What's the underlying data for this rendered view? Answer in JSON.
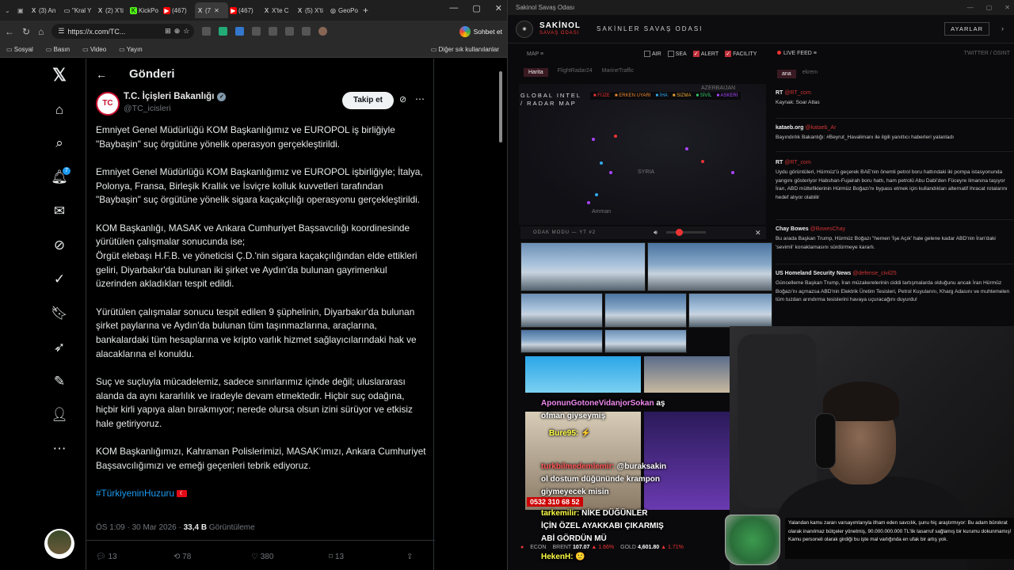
{
  "browser": {
    "tabs": [
      {
        "label": "(3) An",
        "icon": "X"
      },
      {
        "label": "\"Kral Y",
        "icon": "▭"
      },
      {
        "label": "(2) X'ti",
        "icon": "X"
      },
      {
        "label": "KickPo",
        "icon": "K"
      },
      {
        "label": "(467)",
        "icon": "▶"
      },
      {
        "label": "(7",
        "icon": "X"
      },
      {
        "label": "(467)",
        "icon": "▶"
      },
      {
        "label": "X'te C",
        "icon": "X"
      },
      {
        "label": "(5) X'ti",
        "icon": "X"
      },
      {
        "label": "GeoPo",
        "icon": "◎"
      }
    ],
    "url": "https://x.com/TC...",
    "chat_label": "Sohbet et",
    "bookmarks": [
      "Sosyal",
      "Basın",
      "Video",
      "Yayın"
    ],
    "bookmarks_right": "Diğer sık kullanılanlar"
  },
  "x": {
    "page_title": "Gönderi",
    "notifications_badge": "7",
    "account_name": "T.C. İçişleri Bakanlığı",
    "account_handle": "@TC_icisleri",
    "follow_label": "Takip et",
    "tweet_paragraphs": [
      "Emniyet Genel Müdürlüğü KOM Başkanlığımız ve EUROPOL iş birliğiyle \"Baybaşin\" suç örgütüne yönelik operasyon gerçekleştirildi.",
      "Emniyet Genel Müdürlüğü KOM Başkanlığımız ve EUROPOL işbirliğiyle; İtalya, Polonya, Fransa, Birleşik Krallık ve İsviçre kolluk kuvvetleri tarafından \"Baybaşin\" suç örgütüne yönelik sigara kaçakçılığı operasyonu gerçekleştirildi.",
      "KOM Başkanlığı, MASAK ve Ankara Cumhuriyet Başsavcılığı koordinesinde yürütülen çalışmalar sonucunda ise;\nÖrgüt elebaşı H.F.B. ve yöneticisi Ç.D.'nin sigara kaçakçılığından elde ettikleri geliri, Diyarbakır'da bulunan iki şirket ve Aydın'da bulunan gayrimenkul üzerinden akladıkları tespit edildi.",
      "Yürütülen çalışmalar sonucu tespit edilen 9 şüphelinin, Diyarbakır'da bulunan şirket paylarına ve Aydın'da bulunan tüm taşınmazlarına, araçlarına, bankalardaki tüm hesaplarına ve kripto varlık hizmet sağlayıcılarındaki hak ve alacaklarına el konuldu.",
      "Suç ve suçluyla mücadelemiz, sadece sınırlarımız içinde değil; uluslararası alanda da aynı kararlılık ve iradeyle devam etmektedir. Hiçbir suç odağına, hiçbir kirli yapıya alan bırakmıyor; nerede olursa olsun izini sürüyor ve etkisiz hale getiriyoruz.",
      "KOM Başkanlığımızı, Kahraman Polislerimizi, MASAK'ımızı, Ankara Cumhuriyet Başsavcılığımızı ve emeği geçenleri tebrik ediyoruz."
    ],
    "hashtag": "#TürkiyeninHuzuru",
    "time": "ÖS 1:09 · 30 Mar 2026 · ",
    "views": "33,4 B",
    "views_label": " Görüntüleme",
    "replies": "13",
    "reposts": "78",
    "likes": "380",
    "bookmarks": "13"
  },
  "stream": {
    "window_title": "Sakinol Savaş Odası",
    "app_name": "SAKİNOL",
    "app_sub": "SAVAŞ ODASI",
    "room_title": "SAKİNLER SAVAŞ ODASI",
    "settings_label": "AYARLAR",
    "map_label": "MAP ≡",
    "filters": [
      {
        "label": "AIR",
        "on": false
      },
      {
        "label": "SEA",
        "on": false
      },
      {
        "label": "ALERT",
        "on": true
      },
      {
        "label": "FACILITY",
        "on": true
      }
    ],
    "live_feed_label": "LIVE FEED ≡",
    "source_label": "TWITTER / OSINT",
    "map_tabs": [
      "Harita",
      "FlightRadar24",
      "MarineTraffic"
    ],
    "feed_tabs": [
      "ana",
      "ekrem"
    ],
    "map_title_1": "GLOBAL INTEL",
    "map_title_2": "/ RADAR MAP",
    "legend": [
      "FÜZE",
      "ERKEN UYARI",
      "İHA",
      "SIZMA",
      "SİVİL",
      "ASKERİ"
    ],
    "map_places": [
      "AZERBAIJAN",
      "SYRIA",
      "Amman"
    ],
    "feed_posts": [
      {
        "author": "RT",
        "handle": "@RT_com",
        "text": "Kaynak: Soar Atlas"
      },
      {
        "author": "kataeb.org",
        "handle": "@kataeb_Ar",
        "text": "Bayındırlık Bakanlığı: #Beyrut_Havalimanı ile ilgili yanıltıcı haberleri yalanladı"
      },
      {
        "author": "RT",
        "handle": "@RT_com",
        "text": "Uydu görüntüleri, Hürmüz'ü geçerek BAE'nin önemli petrol boru hattındaki iki pompa istasyonunda yangını gösteriyor Habshan-Fujairah boru hattı, ham petrolü Abu Dabi'den Füceyre limanına taşıyor İran, ABD müttefiklerinin Hürmüz Boğazı'nı bypass etmek için kullandıkları alternatif ihracat rotalarını hedef alıyor olabilir"
      },
      {
        "author": "Chay Bowes",
        "handle": "@BowesChay",
        "text": "Bu arada Başkan Trump, Hürmüz Boğazı \"hemen 'İşe Açık' hale gelene kadar ABD'nin İran'daki 'sevimli' konaklamasını sürdürmeye kararlı."
      },
      {
        "author": "US Homeland Security News",
        "handle": "@defense_civil25",
        "text": "Güncelleme Başkan Trump, İran müzakerelerinin ciddi tartışmalarda olduğunu ancak İran Hürmüz Boğazı'nı açmazsa ABD'nin Elektrik Üretim Tesisleri, Petrol Kuyularını, Kharg Adasını ve muhtemelen tüm tuzdan arındırma tesislerini havaya uçuracağını duyurdu!"
      }
    ],
    "focus_label": "ODAK MODU — YT #2",
    "chat_lines": [
      {
        "name": "AponunGotoneVidanjorSokan",
        "text": "aş"
      },
      {
        "name": "",
        "text": "ofman giyseymiş"
      },
      {
        "name": "Bure95:",
        "text": "⚡"
      },
      {
        "name": "turkbilmedemlemir:",
        "text": "@buraksakin"
      },
      {
        "name": "",
        "text": "ol dostum düğününde krampon"
      },
      {
        "name": "",
        "text": "giymeyecek misin"
      },
      {
        "name": "tarkemilir:",
        "text": "NİKE DÜĞÜNLER"
      },
      {
        "name": "",
        "text": "İÇİN ÖZEL AYAKKABI ÇIKARMIŞ"
      },
      {
        "name": "",
        "text": "ABİ GÖRDÜN MÜ"
      },
      {
        "name": "HekenH:",
        "text": "🙂"
      }
    ],
    "phone": "0532 310 68 52",
    "ticker": [
      {
        "label": "ECON",
        "value": ""
      },
      {
        "label": "BRENT",
        "value": "107.07",
        "change": "▲ 1.66%"
      },
      {
        "label": "GOLD",
        "value": "4,601.80",
        "change": "▲ 1.71%"
      }
    ],
    "subtitle": "Yalandan kamu zararı varsayımlarıyla itham eden savcılık, şunu hiç araştırmıyor: Bu adam bürokrat olarak inanılmaz bütçeler yönetmiş, 90.000.000.000 TL'lik tasarruf sağlamış bir kurumu dokunmamış! Kamu personeli olarak girdiği bu işte mal varlığında en ufak bir artış yok."
  }
}
